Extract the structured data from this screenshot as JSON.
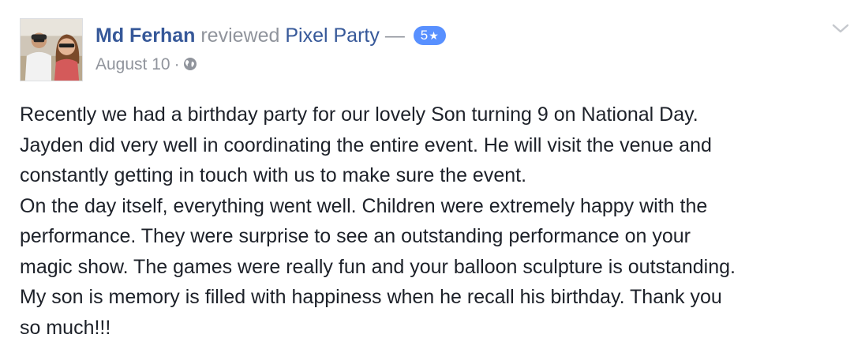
{
  "post": {
    "author": "Md Ferhan",
    "verb": "reviewed",
    "page_name": "Pixel Party",
    "dash": "—",
    "rating": "5",
    "rating_star": "★",
    "date": "August 10",
    "dot": "·",
    "privacy_icon": "globe-icon",
    "menu_icon": "chevron-down-icon",
    "avatar_icon": "profile-photo",
    "body_lines": [
      "Recently we had a birthday party for our lovely Son turning 9 on National Day.",
      "Jayden did very well in coordinating the entire event. He will visit the venue and",
      "constantly getting in touch with us to make sure the event.",
      "On the day itself, everything went well. Children were extremely happy with the",
      "performance. They were surprise to see an outstanding performance on your",
      "magic show. The games were really fun and your balloon sculpture is outstanding.",
      "My son is memory is filled with happiness when he recall his birthday. Thank you",
      "so much!!!"
    ]
  },
  "colors": {
    "link": "#365899",
    "muted": "#90949c",
    "badge": "#5890ff",
    "text": "#1d2129"
  }
}
